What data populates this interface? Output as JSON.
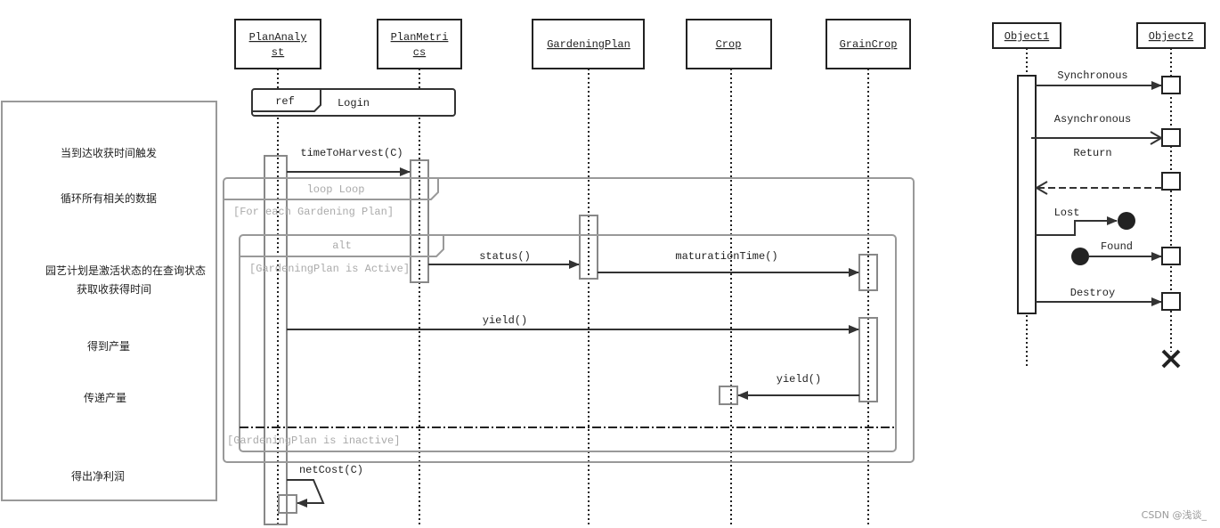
{
  "lifelines": [
    {
      "name": "PlanAnalyst",
      "line1": "PlanAnaly",
      "line2": "st"
    },
    {
      "name": "PlanMetrics",
      "line1": "PlanMetri",
      "line2": "cs"
    },
    {
      "name": "GardeningPlan"
    },
    {
      "name": "Crop"
    },
    {
      "name": "GrainCrop"
    }
  ],
  "notes": [
    "当到达收获时间触发",
    "循环所有相关的数据",
    "园艺计划是激活状态的在查询状态",
    "获取收获得时间",
    "得到产量",
    "传递产量",
    "得出净利润"
  ],
  "ref": {
    "tag": "ref",
    "label": "Login"
  },
  "loop": {
    "tag": "loop  Loop",
    "guard": "[For each Gardening Plan]"
  },
  "alt": {
    "tag": "alt",
    "guard1": "[GardeningPlan is Active]",
    "guard2": "[GardeningPlan is inactive]"
  },
  "messages": {
    "timeToHarvest": "timeToHarvest(C)",
    "status": "status()",
    "maturationTime": "maturationTime()",
    "yield1": "yield()",
    "yield2": "yield()",
    "netCost": "netCost(C)"
  },
  "legend": {
    "object1": "Object1",
    "object2": "Object2",
    "synchronous": "Synchronous",
    "asynchronous": "Asynchronous",
    "return": "Return",
    "lost": "Lost",
    "found": "Found",
    "destroy": "Destroy"
  },
  "watermark": "CSDN @浅谈_"
}
